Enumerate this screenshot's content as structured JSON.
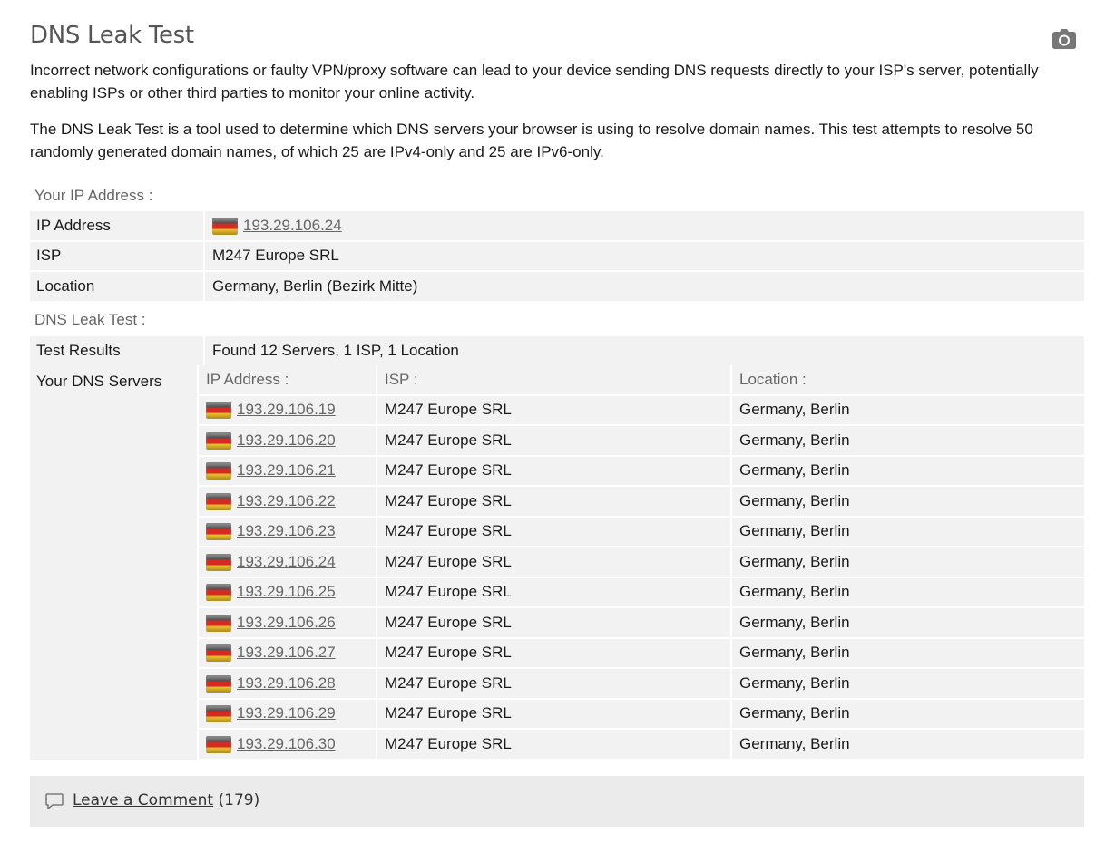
{
  "title": "DNS Leak Test",
  "intro": [
    "Incorrect network configurations or faulty VPN/proxy software can lead to your device sending DNS requests directly to your ISP's server, potentially enabling ISPs or other third parties to monitor your online activity.",
    "The DNS Leak Test is a tool used to determine which DNS servers your browser is using to resolve domain names. This test attempts to resolve 50 randomly generated domain names, of which 25 are IPv4-only and 25 are IPv6-only."
  ],
  "your_ip": {
    "section_label": "Your IP Address :",
    "ip_label": "IP Address",
    "ip_value": "193.29.106.24",
    "isp_label": "ISP",
    "isp_value": "M247 Europe SRL",
    "location_label": "Location",
    "location_value": "Germany, Berlin (Bezirk Mitte)"
  },
  "dns_test": {
    "section_label": "DNS Leak Test :",
    "results_label": "Test Results",
    "results_value": "Found 12 Servers, 1 ISP, 1 Location",
    "servers_label": "Your DNS Servers",
    "columns": [
      "IP Address :",
      "ISP :",
      "Location :"
    ],
    "servers": [
      {
        "ip": "193.29.106.19",
        "isp": "M247 Europe SRL",
        "location": "Germany, Berlin"
      },
      {
        "ip": "193.29.106.20",
        "isp": "M247 Europe SRL",
        "location": "Germany, Berlin"
      },
      {
        "ip": "193.29.106.21",
        "isp": "M247 Europe SRL",
        "location": "Germany, Berlin"
      },
      {
        "ip": "193.29.106.22",
        "isp": "M247 Europe SRL",
        "location": "Germany, Berlin"
      },
      {
        "ip": "193.29.106.23",
        "isp": "M247 Europe SRL",
        "location": "Germany, Berlin"
      },
      {
        "ip": "193.29.106.24",
        "isp": "M247 Europe SRL",
        "location": "Germany, Berlin"
      },
      {
        "ip": "193.29.106.25",
        "isp": "M247 Europe SRL",
        "location": "Germany, Berlin"
      },
      {
        "ip": "193.29.106.26",
        "isp": "M247 Europe SRL",
        "location": "Germany, Berlin"
      },
      {
        "ip": "193.29.106.27",
        "isp": "M247 Europe SRL",
        "location": "Germany, Berlin"
      },
      {
        "ip": "193.29.106.28",
        "isp": "M247 Europe SRL",
        "location": "Germany, Berlin"
      },
      {
        "ip": "193.29.106.29",
        "isp": "M247 Europe SRL",
        "location": "Germany, Berlin"
      },
      {
        "ip": "193.29.106.30",
        "isp": "M247 Europe SRL",
        "location": "Germany, Berlin"
      }
    ]
  },
  "comments": {
    "link_label": "Leave a Comment",
    "count": "(179)"
  },
  "icons": {
    "screenshot": "camera-icon",
    "comment": "comment-icon",
    "flag": "germany-flag-icon"
  },
  "colors": {
    "row_bg": "#f2f2f2",
    "link": "#666666",
    "title": "#555555"
  }
}
